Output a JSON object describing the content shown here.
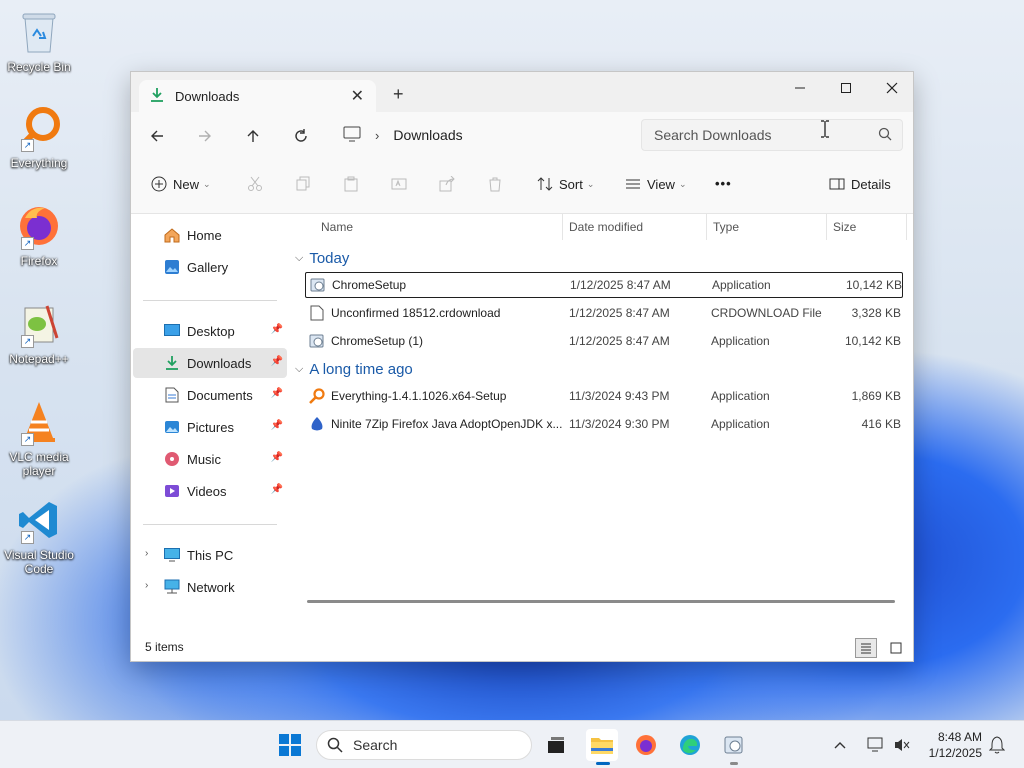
{
  "desktop": {
    "icons": [
      {
        "label": "Recycle Bin",
        "icon": "recycle-bin-icon"
      },
      {
        "label": "Everything",
        "icon": "everything-icon"
      },
      {
        "label": "Firefox",
        "icon": "firefox-icon"
      },
      {
        "label": "Notepad++",
        "icon": "notepadpp-icon"
      },
      {
        "label": "VLC media player",
        "icon": "vlc-icon"
      },
      {
        "label": "Visual Studio Code",
        "icon": "vscode-icon"
      }
    ]
  },
  "window": {
    "tab_title": "Downloads",
    "tab_close": "✕",
    "new_tab": "+",
    "controls": {
      "minimize": "—",
      "maximize": "☐",
      "close": "✕"
    }
  },
  "navbar": {
    "address_location": "Downloads",
    "search_placeholder": "Search Downloads"
  },
  "commands": {
    "new": "New",
    "sort": "Sort",
    "view": "View",
    "more": "•••",
    "details": "Details"
  },
  "sidebar": {
    "top": [
      {
        "label": "Home"
      },
      {
        "label": "Gallery"
      }
    ],
    "pinned": [
      {
        "label": "Desktop"
      },
      {
        "label": "Downloads"
      },
      {
        "label": "Documents"
      },
      {
        "label": "Pictures"
      },
      {
        "label": "Music"
      },
      {
        "label": "Videos"
      }
    ],
    "bottom": [
      {
        "label": "This PC"
      },
      {
        "label": "Network"
      }
    ]
  },
  "filelist": {
    "columns": {
      "name": "Name",
      "date": "Date modified",
      "type": "Type",
      "size": "Size"
    },
    "groups": [
      {
        "title": "Today",
        "rows": [
          {
            "name": "ChromeSetup",
            "date": "1/12/2025 8:47 AM",
            "type": "Application",
            "size": "10,142 KB"
          },
          {
            "name": "Unconfirmed 18512.crdownload",
            "date": "1/12/2025 8:47 AM",
            "type": "CRDOWNLOAD File",
            "size": "3,328 KB"
          },
          {
            "name": "ChromeSetup (1)",
            "date": "1/12/2025 8:47 AM",
            "type": "Application",
            "size": "10,142 KB"
          }
        ]
      },
      {
        "title": "A long time ago",
        "rows": [
          {
            "name": "Everything-1.4.1.1026.x64-Setup",
            "date": "11/3/2024 9:43 PM",
            "type": "Application",
            "size": "1,869 KB"
          },
          {
            "name": "Ninite 7Zip Firefox Java AdoptOpenJDK x...",
            "date": "11/3/2024 9:30 PM",
            "type": "Application",
            "size": "416 KB"
          }
        ]
      }
    ]
  },
  "status": {
    "item_count": "5 items"
  },
  "taskbar": {
    "search_label": "Search",
    "time": "8:48 AM",
    "date": "1/12/2025"
  },
  "colors": {
    "accent": "#0067c0",
    "group_header": "#1a5aa8"
  }
}
